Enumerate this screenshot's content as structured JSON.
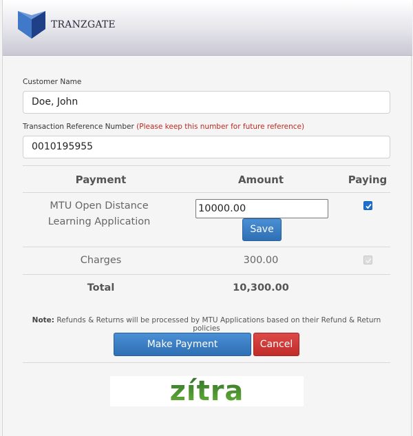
{
  "brand": {
    "name": "TRANZGATE"
  },
  "customer": {
    "label": "Customer Name",
    "value": "Doe, John"
  },
  "transaction": {
    "label": "Transaction Reference Number",
    "note": "(Please keep this number for future reference)",
    "value": "0010195955"
  },
  "table": {
    "headers": {
      "payment": "Payment",
      "amount": "Amount",
      "paying": "Paying"
    },
    "rows": [
      {
        "payment_line1": "MTU Open Distance",
        "payment_line2": "Learning Application",
        "amount": "10000.00",
        "paying": true
      },
      {
        "payment": "Charges",
        "amount": "300.00",
        "paying": true
      }
    ],
    "save_label": "Save",
    "total_label": "Total",
    "total_value": "10,300.00"
  },
  "note": {
    "label": "Note:",
    "text": "Refunds & Returns will be processed by MTU Applications based on their Refund & Return policies"
  },
  "actions": {
    "make_payment": "Make Payment",
    "cancel": "Cancel"
  },
  "partner": {
    "name": "zítra"
  },
  "colors": {
    "primary": "#2f6fb4",
    "danger": "#c12b29",
    "note_red": "#c0281e",
    "zitra_green": "#4a9a30"
  }
}
